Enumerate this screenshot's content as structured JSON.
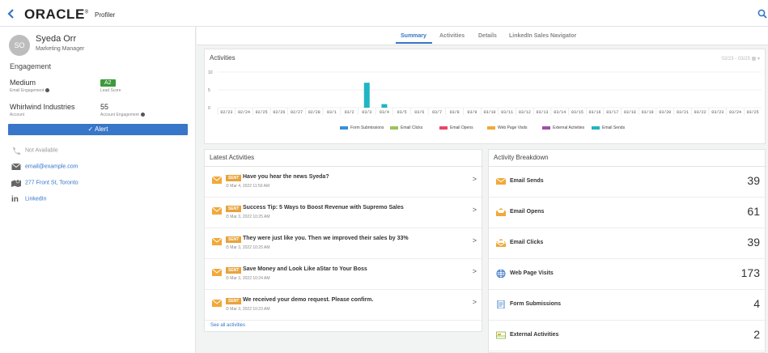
{
  "app": {
    "logo": "ORACLE",
    "app_name": "Profiler"
  },
  "profile": {
    "initials": "SO",
    "name": "Syeda Orr",
    "title": "Marketing Manager",
    "engagement_title": "Engagement",
    "email_engagement": {
      "value": "Medium",
      "label": "Email Engagement"
    },
    "lead_score": {
      "value": "A2",
      "label": "Lead Score"
    },
    "account": {
      "value": "Whirlwind Industries",
      "label": "Account"
    },
    "account_engagement": {
      "value": "55",
      "label": "Account Engagement"
    },
    "alert_label": "✓ Alert",
    "phone": "Not Available",
    "email": "email@example.com",
    "address": "277 Front St, Toronto",
    "linkedin": "LinkedIn"
  },
  "tabs": [
    "Summary",
    "Activities",
    "Details",
    "LinkedIn Sales Navigator"
  ],
  "activity_chart": {
    "title": "Activities",
    "range": "02/23 - 03/25 ▦ ▾",
    "y_ticks": [
      "10",
      "5",
      "0"
    ],
    "x_labels": [
      "02/23",
      "02/24",
      "02/25",
      "02/26",
      "02/27",
      "02/28",
      "03/1",
      "03/2",
      "03/3",
      "03/4",
      "03/5",
      "03/6",
      "03/7",
      "03/8",
      "03/9",
      "03/10",
      "03/11",
      "03/12",
      "03/13",
      "03/14",
      "03/15",
      "03/16",
      "03/17",
      "03/18",
      "03/19",
      "03/20",
      "03/21",
      "03/22",
      "03/23",
      "03/24",
      "03/25"
    ],
    "legend": [
      {
        "name": "Form Submissions",
        "color": "#3a8fd8"
      },
      {
        "name": "Email Clicks",
        "color": "#9bc35a"
      },
      {
        "name": "Email Opens",
        "color": "#e8476a"
      },
      {
        "name": "Web Page Visits",
        "color": "#f0a93a"
      },
      {
        "name": "External Activities",
        "color": "#a04fa8"
      },
      {
        "name": "Email Sends",
        "color": "#1fb5c4"
      }
    ]
  },
  "chart_data": {
    "type": "bar",
    "title": "Activities",
    "categories": [
      "02/23",
      "02/24",
      "02/25",
      "02/26",
      "02/27",
      "02/28",
      "03/1",
      "03/2",
      "03/3",
      "03/4",
      "03/5",
      "03/6",
      "03/7",
      "03/8",
      "03/9",
      "03/10",
      "03/11",
      "03/12",
      "03/13",
      "03/14",
      "03/15",
      "03/16",
      "03/17",
      "03/18",
      "03/19",
      "03/20",
      "03/21",
      "03/22",
      "03/23",
      "03/24",
      "03/25"
    ],
    "series": [
      {
        "name": "Email Sends",
        "values": [
          0,
          0,
          0,
          0,
          0,
          0,
          0,
          0,
          7,
          1,
          0,
          0,
          0,
          0,
          0,
          0,
          0,
          0,
          0,
          0,
          0,
          0,
          0,
          0,
          0,
          0,
          0,
          0,
          0,
          0,
          0
        ]
      }
    ],
    "ylim": [
      0,
      10
    ],
    "grid": true,
    "legend_position": "bottom"
  },
  "latest": {
    "title": "Latest Activities",
    "see_all": "See all activities",
    "items": [
      {
        "badge": "SENT",
        "title": "Have you hear the news Syeda?",
        "date": "⏱ Mar 4, 2022 11:50 AM"
      },
      {
        "badge": "SENT",
        "title": "Success Tip: 5 Ways to Boost Revenue with Supremo Sales",
        "date": "⏱ Mar 3, 2022 10:25 AM"
      },
      {
        "badge": "SENT",
        "title": "They were just like you. Then we improved their sales by 33%",
        "date": "⏱ Mar 3, 2022 10:25 AM"
      },
      {
        "badge": "SENT",
        "title": "Save Money and Look Like aStar to Your Boss",
        "date": "⏱ Mar 3, 2022 10:24 AM"
      },
      {
        "badge": "SENT",
        "title": "We received your demo request. Please confirm.",
        "date": "⏱ Mar 3, 2022 10:23 AM"
      }
    ]
  },
  "breakdown": {
    "title": "Activity Breakdown",
    "items": [
      {
        "label": "Email Sends",
        "value": "39",
        "icon": "email-send-icon"
      },
      {
        "label": "Email Opens",
        "value": "61",
        "icon": "email-open-icon"
      },
      {
        "label": "Email Clicks",
        "value": "39",
        "icon": "email-click-icon"
      },
      {
        "label": "Web Page Visits",
        "value": "173",
        "icon": "globe-icon"
      },
      {
        "label": "Form Submissions",
        "value": "4",
        "icon": "form-icon"
      },
      {
        "label": "External Activities",
        "value": "2",
        "icon": "external-activity-icon"
      }
    ]
  }
}
